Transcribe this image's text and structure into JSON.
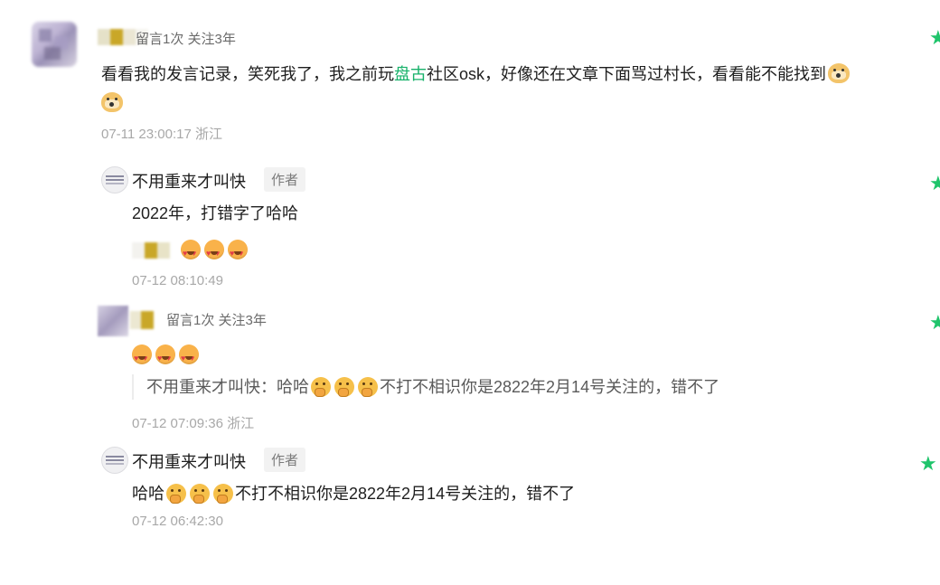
{
  "comment": {
    "meta": "留言1次 关注3年",
    "text_before": "看看我的发言记录，笑死我了，我之前玩",
    "text_link": "盘古",
    "text_after": "社区osk，好像还在文章下面骂过村长，看看能不能找到",
    "time": "07-11 23:00:17 浙江"
  },
  "reply1": {
    "author": "不用重来才叫快",
    "badge": "作者",
    "text": "2022年，打错字了哈哈",
    "time": "07-12 08:10:49"
  },
  "reply2": {
    "meta": "留言1次 关注3年",
    "quote_prefix": "不用重来才叫快：哈哈",
    "quote_suffix": "不打不相识你是2822年2月14号关注的，错不了",
    "time": "07-12 07:09:36 浙江"
  },
  "reply3": {
    "author": "不用重来才叫快",
    "badge": "作者",
    "text_prefix": "哈哈",
    "text_suffix": "不打不相识你是2822年2月14号关注的，错不了",
    "time": "07-12 06:42:30"
  },
  "icons": {
    "like": "star-icon",
    "emoji_doge": "doge-emoji-icon",
    "emoji_heart": "heart-eyes-emoji-icon",
    "emoji_think": "thinking-emoji-icon"
  },
  "colors": {
    "accent_green": "#1fc46b",
    "link_green": "#17b26a",
    "time_gray": "#a8a8a8"
  }
}
